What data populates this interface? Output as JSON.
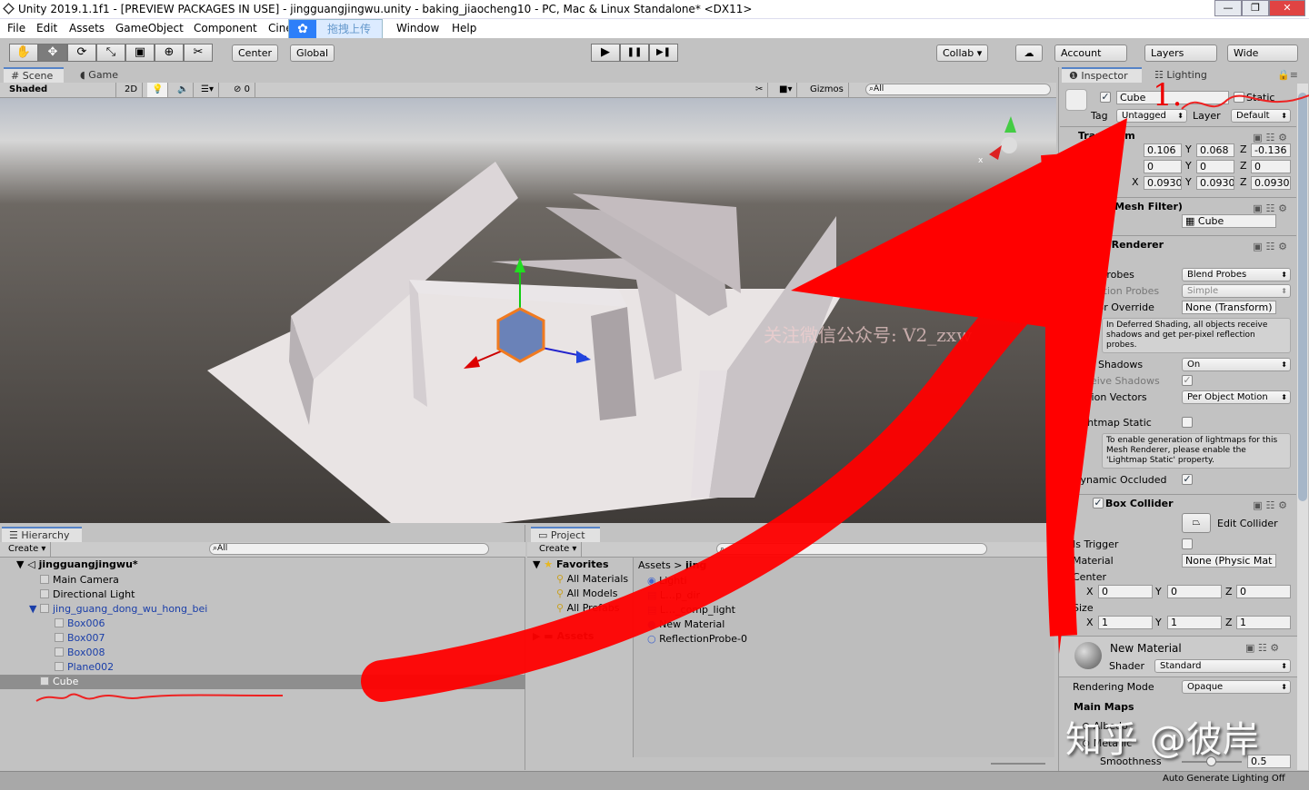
{
  "window": {
    "title": "Unity 2019.1.1f1 - [PREVIEW PACKAGES IN USE] - jingguangjingwu.unity - baking_jiaocheng10 - PC, Mac & Linux Standalone* <DX11>",
    "min": "—",
    "max": "❐",
    "close": "✕"
  },
  "menu": [
    "File",
    "Edit",
    "Assets",
    "GameObject",
    "Component",
    "Cine",
    "Window",
    "Help"
  ],
  "upload_overlay": "拖拽上传",
  "toolbar": {
    "tools": [
      "✋",
      "✥",
      "⟳",
      "⤡",
      "▣",
      "⊕",
      "✂"
    ],
    "pivot": "Center",
    "space": "Global",
    "play": "▶",
    "pause": "❚❚",
    "step": "▶❚",
    "collab": "Collab ▾",
    "cloud": "☁",
    "account": "Account",
    "layers": "Layers",
    "layout": "Wide"
  },
  "scene": {
    "tabs": [
      "Scene",
      "Game"
    ],
    "shading": "Shaded",
    "mode2d": "2D",
    "hidden_count": "0",
    "gizmos": "Gizmos",
    "search": "All",
    "axis_x": "x",
    "watermark": "关注微信公众号: V2_zxw"
  },
  "inspector": {
    "tabs": [
      "Inspector",
      "Lighting"
    ],
    "name": "Cube",
    "static": "Static",
    "tag_label": "Tag",
    "tag": "Untagged",
    "layer_label": "Layer",
    "layer": "Default",
    "transform": {
      "title": "Transform",
      "position": [
        "0.106",
        "0.068",
        "-0.136"
      ],
      "rotation": [
        "0",
        "0",
        "0"
      ],
      "scale": [
        "0.0930",
        "0.0930",
        "0.0930"
      ]
    },
    "mesh_filter": {
      "title": "Cube (Mesh Filter)",
      "mesh": "Cube"
    },
    "mesh_renderer": {
      "title": "Mesh Renderer",
      "light_probes_label": "Light Probes",
      "light_probes": "Blend Probes",
      "reflection_label": "Reflection Probes",
      "reflection": "Simple",
      "anchor_label": "Anchor Override",
      "anchor": "None (Transform)",
      "deferred_note": "In Deferred Shading, all objects receive shadows and get per-pixel reflection probes.",
      "cast_label": "Cast Shadows",
      "cast": "On",
      "receive_label": "Receive Shadows",
      "motion_label": "Motion Vectors",
      "motion": "Per Object Motion",
      "lightmap_label": "Lightmap Static",
      "lightmap_note": "To enable generation of lightmaps for this Mesh Renderer, please enable the 'Lightmap Static' property.",
      "occluded_label": "Dynamic Occluded"
    },
    "box_collider": {
      "title": "Box Collider",
      "edit": "Edit Collider",
      "trigger_label": "Is Trigger",
      "material_label": "Material",
      "material": "None (Physic Mat",
      "center_label": "Center",
      "center": [
        "0",
        "0",
        "0"
      ],
      "size_label": "Size",
      "size": [
        "1",
        "1",
        "1"
      ]
    },
    "material": {
      "name": "New Material",
      "shader_label": "Shader",
      "shader": "Standard",
      "rendering_label": "Rendering Mode",
      "rendering": "Opaque",
      "main_maps": "Main Maps",
      "albedo": "Albedo",
      "metallic": "Metallic",
      "smoothness_label": "Smoothness",
      "smoothness": "0.5"
    },
    "annotation": "1."
  },
  "hierarchy": {
    "tab": "Hierarchy",
    "create": "Create",
    "search": "All",
    "scene": "jingguangjingwu*",
    "items": [
      {
        "name": "Main Camera",
        "depth": 1
      },
      {
        "name": "Directional Light",
        "depth": 1
      },
      {
        "name": "jing_guang_dong_wu_hong_bei",
        "depth": 1,
        "prefab": true
      },
      {
        "name": "Box006",
        "depth": 2,
        "prefab": true
      },
      {
        "name": "Box007",
        "depth": 2,
        "prefab": true
      },
      {
        "name": "Box008",
        "depth": 2,
        "prefab": true
      },
      {
        "name": "Plane002",
        "depth": 2,
        "prefab": true
      },
      {
        "name": "Cube",
        "depth": 1,
        "selected": true
      }
    ]
  },
  "project": {
    "tab": "Project",
    "create": "Create",
    "favorites": "Favorites",
    "fav_items": [
      "All Materials",
      "All Models",
      "All Prefabs"
    ],
    "assets": "Assets",
    "breadcrumb": [
      "Assets",
      "jing"
    ],
    "files": [
      "Lighti",
      "L…p_dir",
      "L…_comp_light",
      "New Material",
      "ReflectionProbe-0"
    ]
  },
  "status": {
    "text": "Auto Generate Lighting Off"
  },
  "watermark": "知乎 @彼岸",
  "colors": {
    "annotation_red": "#ff0000",
    "selection": "#8e8e8e",
    "accent": "#5683c7"
  }
}
